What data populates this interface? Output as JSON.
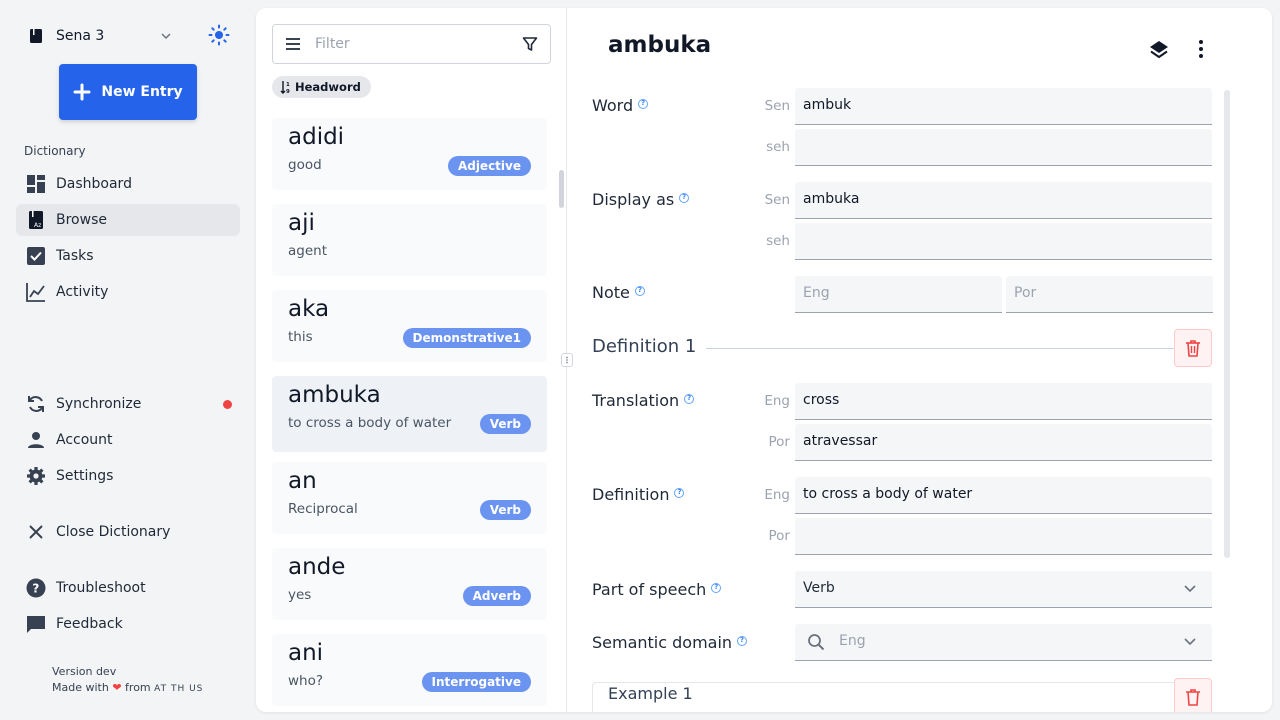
{
  "sidebar": {
    "project_name": "Sena 3",
    "new_entry_label": "New Entry",
    "section_label": "Dictionary",
    "nav": [
      {
        "label": "Dashboard"
      },
      {
        "label": "Browse"
      },
      {
        "label": "Tasks"
      },
      {
        "label": "Activity"
      }
    ],
    "bottom": [
      {
        "label": "Synchronize"
      },
      {
        "label": "Account"
      },
      {
        "label": "Settings"
      },
      {
        "label": "Close Dictionary"
      },
      {
        "label": "Troubleshoot"
      },
      {
        "label": "Feedback"
      }
    ],
    "version": "Version dev",
    "made_with": "Made with",
    "from": "from",
    "org": "AT TH US"
  },
  "list": {
    "filter_placeholder": "Filter",
    "sort_label": "Headword",
    "entries": [
      {
        "headword": "adidi",
        "gloss": "good",
        "pos": "Adjective"
      },
      {
        "headword": "aji",
        "gloss": "agent",
        "pos": ""
      },
      {
        "headword": "aka",
        "gloss": "this",
        "pos": "Demonstrative1"
      },
      {
        "headword": "ambuka",
        "gloss": "to cross a body of water",
        "pos": "Verb"
      },
      {
        "headword": "an",
        "gloss": "Reciprocal",
        "pos": "Verb"
      },
      {
        "headword": "ande",
        "gloss": "yes",
        "pos": "Adverb"
      },
      {
        "headword": "ani",
        "gloss": "who?",
        "pos": "Interrogative"
      }
    ]
  },
  "editor": {
    "title": "ambuka",
    "word_label": "Word",
    "word_ws1": "Sen",
    "word_val1": "ambuk",
    "word_ws2": "seh",
    "word_val2": "",
    "display_label": "Display as",
    "display_ws1": "Sen",
    "display_val1": "ambuka",
    "display_ws2": "seh",
    "display_val2": "",
    "note_label": "Note",
    "note_ph1": "Eng",
    "note_ph2": "Por",
    "definition_heading": "Definition 1",
    "translation_label": "Translation",
    "trans_ws1": "Eng",
    "trans_val1": "cross",
    "trans_ws2": "Por",
    "trans_val2": "atravessar",
    "definition_label": "Definition",
    "def_ws1": "Eng",
    "def_val1": "to cross a body of water",
    "def_ws2": "Por",
    "def_val2": "",
    "pos_label": "Part of speech",
    "pos_value": "Verb",
    "semantic_label": "Semantic domain",
    "semantic_ph": "Eng",
    "example_label": "Example 1"
  },
  "colors": {
    "accent": "#2563eb",
    "pos_badge": "#6b93f0",
    "sync_dot": "#ef4444"
  }
}
